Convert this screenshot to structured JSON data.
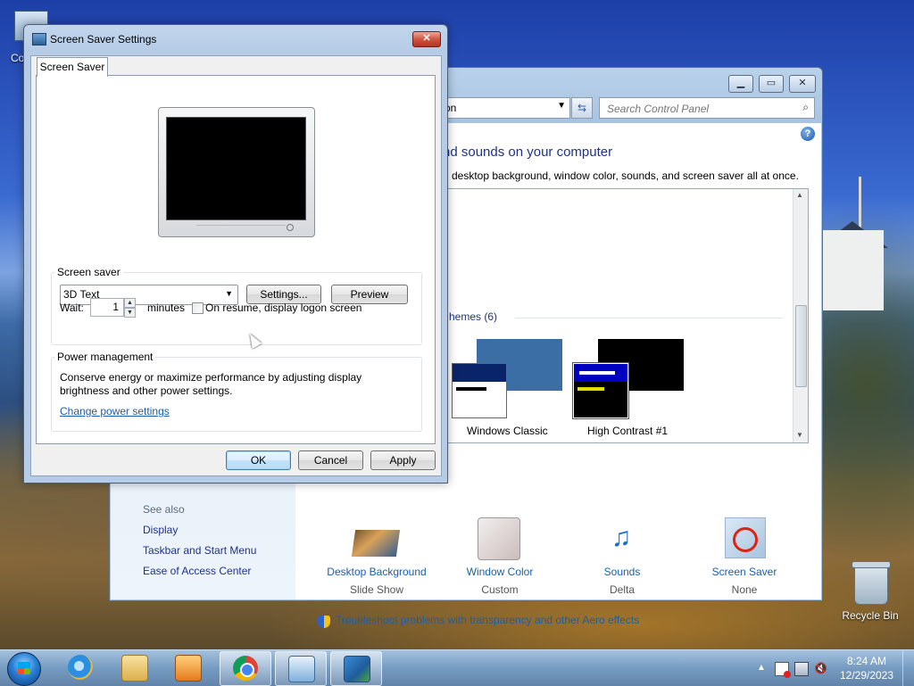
{
  "desktop": {
    "computer_label": "Co",
    "recycle_bin_label": "Recycle Bin"
  },
  "control_panel": {
    "address_text": "on",
    "search_placeholder": "Search Control Panel",
    "heading": "nd sounds on your computer",
    "subheading": "desktop background, window color, sounds, and screen saver all at once.",
    "themes_section_label": "hemes (6)",
    "themes": [
      {
        "name": "Windows Classic",
        "accent": "#3a6ea5"
      },
      {
        "name": "High Contrast #1",
        "accent": "#000000"
      }
    ],
    "items": [
      {
        "label": "Desktop Background",
        "sub": "Slide Show",
        "icon": "desktop-background-icon"
      },
      {
        "label": "Window Color",
        "sub": "Custom",
        "icon": "window-color-icon"
      },
      {
        "label": "Sounds",
        "sub": "Delta",
        "icon": "sounds-icon"
      },
      {
        "label": "Screen Saver",
        "sub": "None",
        "icon": "screen-saver-icon"
      }
    ],
    "see_also": "See also",
    "left_links": [
      "Display",
      "Taskbar and Start Menu",
      "Ease of Access Center"
    ],
    "troubleshoot_link": "Troubleshoot problems with transparency and other Aero effects"
  },
  "screen_saver_dialog": {
    "title": "Screen Saver Settings",
    "close_label": "✕",
    "tab_label": "Screen Saver",
    "screen_saver_group_label": "Screen saver",
    "selected_screen_saver": "3D Text",
    "settings_button": "Settings...",
    "preview_button": "Preview",
    "wait_label": "Wait:",
    "wait_value": "1",
    "minutes_label": "minutes",
    "resume_checkbox_label": "On resume, display logon screen",
    "resume_checked": false,
    "power_group_label": "Power management",
    "power_description_line1": "Conserve energy or maximize performance by adjusting display",
    "power_description_line2": "brightness and other power settings.",
    "power_link": "Change power settings",
    "ok_button": "OK",
    "cancel_button": "Cancel",
    "apply_button": "Apply"
  },
  "taskbar": {
    "pinned": [
      "internet-explorer-icon",
      "windows-explorer-icon",
      "media-player-icon",
      "chrome-icon",
      "control-panel-icon",
      "screen-saver-settings-icon"
    ],
    "clock_time": "8:24 AM",
    "clock_date": "12/29/2023"
  }
}
